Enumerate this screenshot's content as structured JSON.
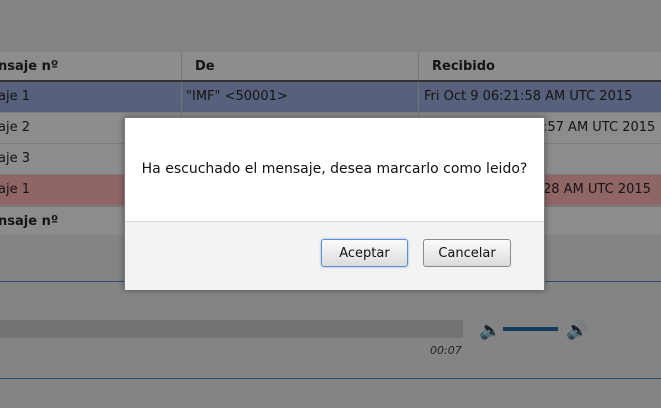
{
  "table": {
    "headers": [
      "nsaje nº",
      "De",
      "Recibido"
    ],
    "rows": [
      {
        "col1": "aje 1",
        "col2": "\"IMF\" <50001>",
        "col3": "Fri Oct 9 06:21:58 AM UTC 2015",
        "state": "selected"
      },
      {
        "col1": "aje 2",
        "col2": "",
        "col3": ":57 AM UTC 2015",
        "state": "plain"
      },
      {
        "col1": "aje 3",
        "col2": "",
        "col3": "",
        "state": "plain"
      },
      {
        "col1": "aje 1",
        "col2": "",
        "col3": "28 AM UTC 2015",
        "state": "unread"
      }
    ],
    "footer": "nsaje nº"
  },
  "player": {
    "time": "00:07",
    "volume_fraction": 0.75,
    "icons": [
      "volume-low-icon",
      "volume-high-icon"
    ]
  },
  "dialog": {
    "message": "Ha escuchado el mensaje, desea marcarlo como leido?",
    "accept_label": "Aceptar",
    "cancel_label": "Cancelar"
  },
  "colors": {
    "selected_row": "#8e9dc8",
    "unread_row": "#e7a3a3",
    "accent": "#1f5f9a"
  }
}
